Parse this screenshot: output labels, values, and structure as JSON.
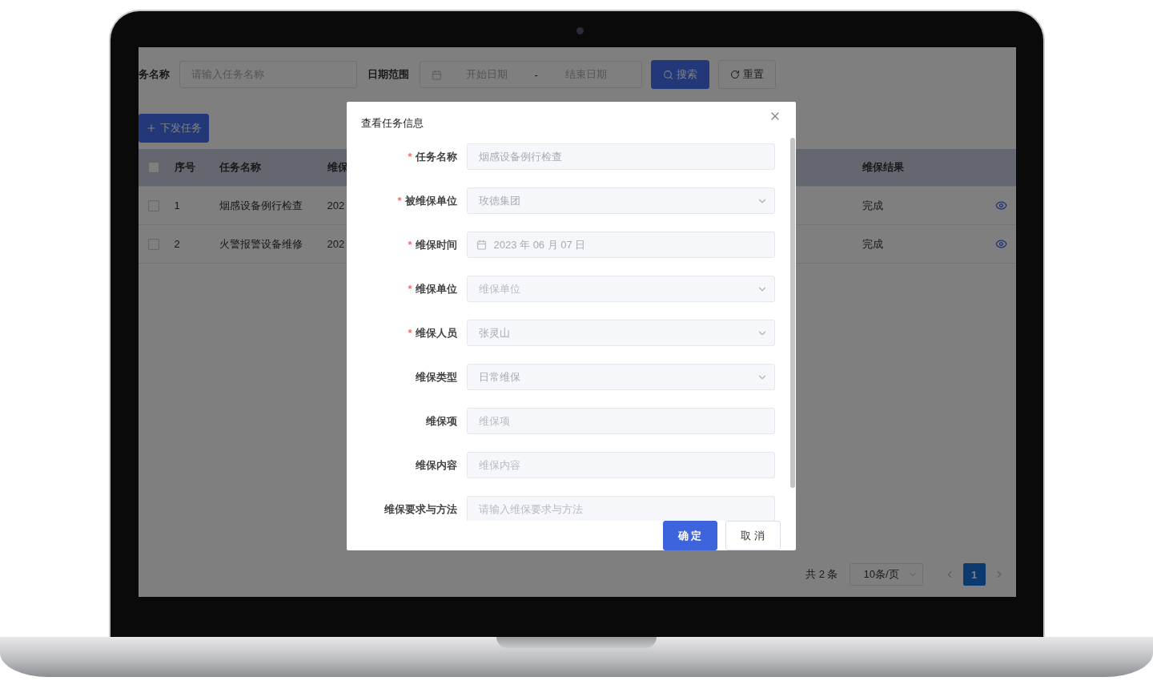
{
  "search_bar": {
    "task_name_label": "务名称",
    "task_name_placeholder": "请输入任务名称",
    "date_label": "日期范围",
    "start_placeholder": "开始日期",
    "separator": "-",
    "end_placeholder": "结束日期",
    "search_button": "搜索",
    "reset_button": "重置"
  },
  "toolbar": {
    "add_button": "下发任务"
  },
  "table": {
    "header_checked": false,
    "columns": [
      {
        "label": "序号"
      },
      {
        "label": "任务名称"
      },
      {
        "label": "维保"
      },
      {
        "label": "维保结果"
      }
    ],
    "rows": [
      {
        "checked": false,
        "index": "1",
        "name": "烟感设备例行检查",
        "column_4": "202",
        "result": "完成"
      },
      {
        "checked": false,
        "index": "2",
        "name": "火警报警设备维修",
        "column_4": "202",
        "result": "完成"
      }
    ]
  },
  "pagination": {
    "total": "共 2 条",
    "page_size": "10条/页",
    "pages": [
      {
        "label": "1",
        "selected": true
      }
    ]
  },
  "dialog": {
    "title": "查看任务信息",
    "required_mark": "*",
    "fields": [
      {
        "label": "任务名称",
        "required": true,
        "kind": "input",
        "value": "烟感设备例行检查"
      },
      {
        "label": "被维保单位",
        "required": true,
        "kind": "select",
        "value": "玫德集团"
      },
      {
        "label": "维保时间",
        "required": true,
        "kind": "date",
        "value": "2023 年 06 月 07 日"
      },
      {
        "label": "维保单位",
        "required": true,
        "kind": "select",
        "placeholder": "维保单位"
      },
      {
        "label": "维保人员",
        "required": true,
        "kind": "select",
        "value": "张灵山"
      },
      {
        "label": "维保类型",
        "required": false,
        "kind": "select",
        "value": "日常维保"
      },
      {
        "label": "维保项",
        "required": false,
        "kind": "input",
        "placeholder": "维保项"
      },
      {
        "label": "维保内容",
        "required": false,
        "kind": "input",
        "placeholder": "维保内容"
      },
      {
        "label": "维保要求与方法",
        "required": false,
        "kind": "input",
        "placeholder": "请输入维保要求与方法"
      }
    ],
    "buttons": [
      {
        "label": "确 定",
        "kind": "primary"
      },
      {
        "label": "取 消",
        "kind": "default"
      }
    ]
  }
}
